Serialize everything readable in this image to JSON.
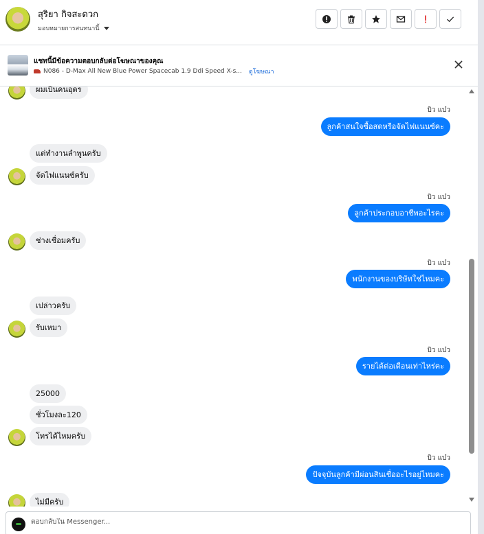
{
  "header": {
    "contact_name": "สุริยา กิจสะดวก",
    "assign_label": "มอบหมายการสนทนานี้",
    "actions": [
      {
        "name": "report-spam-button",
        "icon": "alert-circle-icon"
      },
      {
        "name": "delete-button",
        "icon": "trash-icon"
      },
      {
        "name": "star-button",
        "icon": "star-icon"
      },
      {
        "name": "mark-unread-button",
        "icon": "envelope-icon"
      },
      {
        "name": "follow-up-button",
        "icon": "exclamation-icon"
      },
      {
        "name": "mark-done-button",
        "icon": "check-icon"
      }
    ]
  },
  "ad": {
    "title": "แชทนี้มีข้อความตอบกลับต่อโฆษณาของคุณ",
    "item": "N086 - D-Max All New Blue Power Spacecab 1.9 Ddi Speed X-s...",
    "view_link": "ดูโฆษณา"
  },
  "messages": [
    {
      "dir": "in",
      "text": "ผมเป็นคนอุดร"
    },
    {
      "dir": "out",
      "sender": "บิว แบ๋ว",
      "text": "ลูกค้าสนใจซื้อสดหรือจัดไฟแนนซ์คะ"
    },
    {
      "dir": "in",
      "text": "แต่ทำงานลำพูนครับ"
    },
    {
      "dir": "in",
      "text": "จัดไฟแนนซ์ครับ"
    },
    {
      "dir": "out",
      "sender": "บิว แบ๋ว",
      "text": "ลูกค้าประกอบอาชีพอะไรคะ"
    },
    {
      "dir": "in",
      "text": "ช่างเชื่อมครับ"
    },
    {
      "dir": "out",
      "sender": "บิว แบ๋ว",
      "text": "พนักงานของบริษัทใช่ไหมคะ"
    },
    {
      "dir": "in",
      "text": "เปล่าวครับ"
    },
    {
      "dir": "in",
      "text": "รับเหมา"
    },
    {
      "dir": "out",
      "sender": "บิว แบ๋ว",
      "text": "รายได้ต่อเดือนเท่าไหร่คะ"
    },
    {
      "dir": "in",
      "text": "25000"
    },
    {
      "dir": "in",
      "text": "ชั่วโมงละ120"
    },
    {
      "dir": "in",
      "text": "โทรได้ไหมครับ"
    },
    {
      "dir": "out",
      "sender": "บิว แบ๋ว",
      "text": "ปัจจุบันลูกค้ามีผ่อนสินเชื่ออะไรอยู่ไหมคะ"
    },
    {
      "dir": "in",
      "text": "ไม่มีครับ"
    }
  ],
  "reply": {
    "placeholder": "ตอบกลับใน Messenger..."
  },
  "colors": {
    "outgoing_bubble": "#0a7cff",
    "incoming_bubble": "#eeeff1",
    "link": "#216fdb"
  }
}
